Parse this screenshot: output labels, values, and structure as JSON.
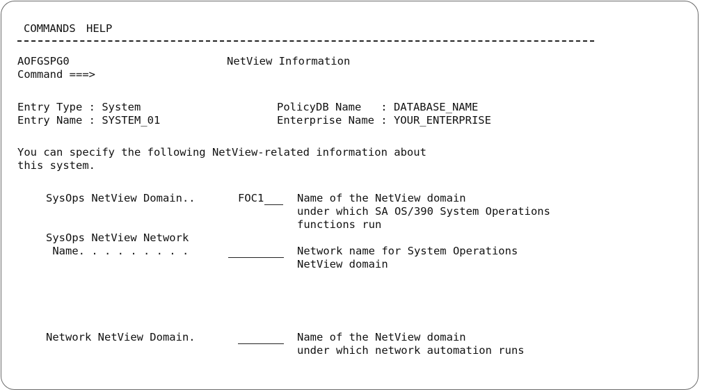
{
  "menu": {
    "commands": "COMMANDS",
    "help": "HELP"
  },
  "header": {
    "panel_id": "AOFGSPG0",
    "title": "NetView Information",
    "command_prompt": "Command ===>"
  },
  "entry": {
    "type_label": "Entry Type : System",
    "name_label": "Entry Name : SYSTEM_01",
    "policydb_label": "PolicyDB Name   : DATABASE_NAME",
    "enterprise_label": "Enterprise Name : YOUR_ENTERPRISE"
  },
  "intro": {
    "line1": "You can specify the following NetView-related information about",
    "line2": "this system."
  },
  "fields": {
    "sysops_domain": {
      "label": "SysOps NetView Domain..",
      "value": "FOC1",
      "desc1": "Name of the NetView domain",
      "desc2": "under which SA OS/390 System Operations",
      "desc3": "functions run"
    },
    "sysops_network": {
      "label1": "SysOps NetView Network",
      "label2": " Name. . . . . . . . .",
      "value": "",
      "desc1": "Network name for System Operations",
      "desc2": "NetView domain"
    },
    "network_domain": {
      "label": "Network NetView Domain.",
      "value": "",
      "desc1": "Name of the NetView domain",
      "desc2": "under which network automation runs"
    }
  }
}
